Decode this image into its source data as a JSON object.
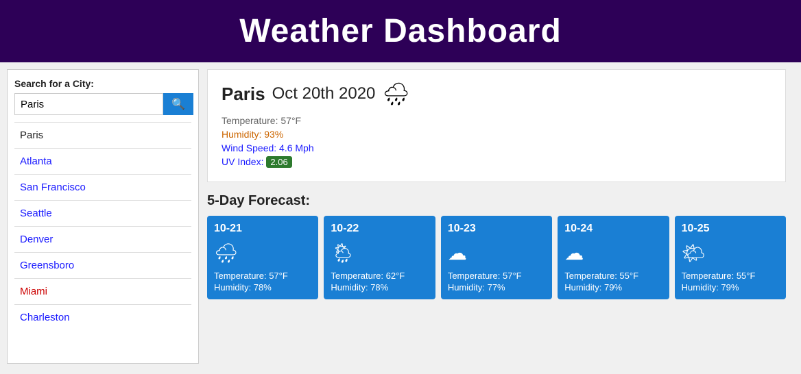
{
  "header": {
    "title": "Weather Dashboard"
  },
  "sidebar": {
    "search_label": "Search for a City:",
    "search_placeholder": "Paris",
    "search_value": "Paris",
    "search_button_label": "🔍",
    "cities": [
      {
        "name": "Paris",
        "color": "dark"
      },
      {
        "name": "Atlanta",
        "color": "blue"
      },
      {
        "name": "San Francisco",
        "color": "blue"
      },
      {
        "name": "Seattle",
        "color": "blue"
      },
      {
        "name": "Denver",
        "color": "blue"
      },
      {
        "name": "Greensboro",
        "color": "blue"
      },
      {
        "name": "Miami",
        "color": "red"
      },
      {
        "name": "Charleston",
        "color": "blue"
      }
    ]
  },
  "current_weather": {
    "city": "Paris",
    "date": "Oct 20th 2020",
    "icon": "🌧",
    "temperature": "Temperature: 57°F",
    "humidity": "Humidity: 93%",
    "wind_speed": "Wind Speed: 4.6 Mph",
    "uv_label": "UV Index:",
    "uv_value": "2.06"
  },
  "forecast": {
    "title": "5-Day Forecast:",
    "days": [
      {
        "date": "10-21",
        "icon": "rainy-cloud",
        "temperature": "Temperature: 57°F",
        "humidity": "Humidity: 78%"
      },
      {
        "date": "10-22",
        "icon": "cloud-rain",
        "temperature": "Temperature: 62°F",
        "humidity": "Humidity: 78%"
      },
      {
        "date": "10-23",
        "icon": "cloudy",
        "temperature": "Temperature: 57°F",
        "humidity": "Humidity: 77%"
      },
      {
        "date": "10-24",
        "icon": "cloudy",
        "temperature": "Temperature: 55°F",
        "humidity": "Humidity: 79%"
      },
      {
        "date": "10-25",
        "icon": "partly-cloudy",
        "temperature": "Temperature: 55°F",
        "humidity": "Humidity: 79%"
      }
    ]
  }
}
